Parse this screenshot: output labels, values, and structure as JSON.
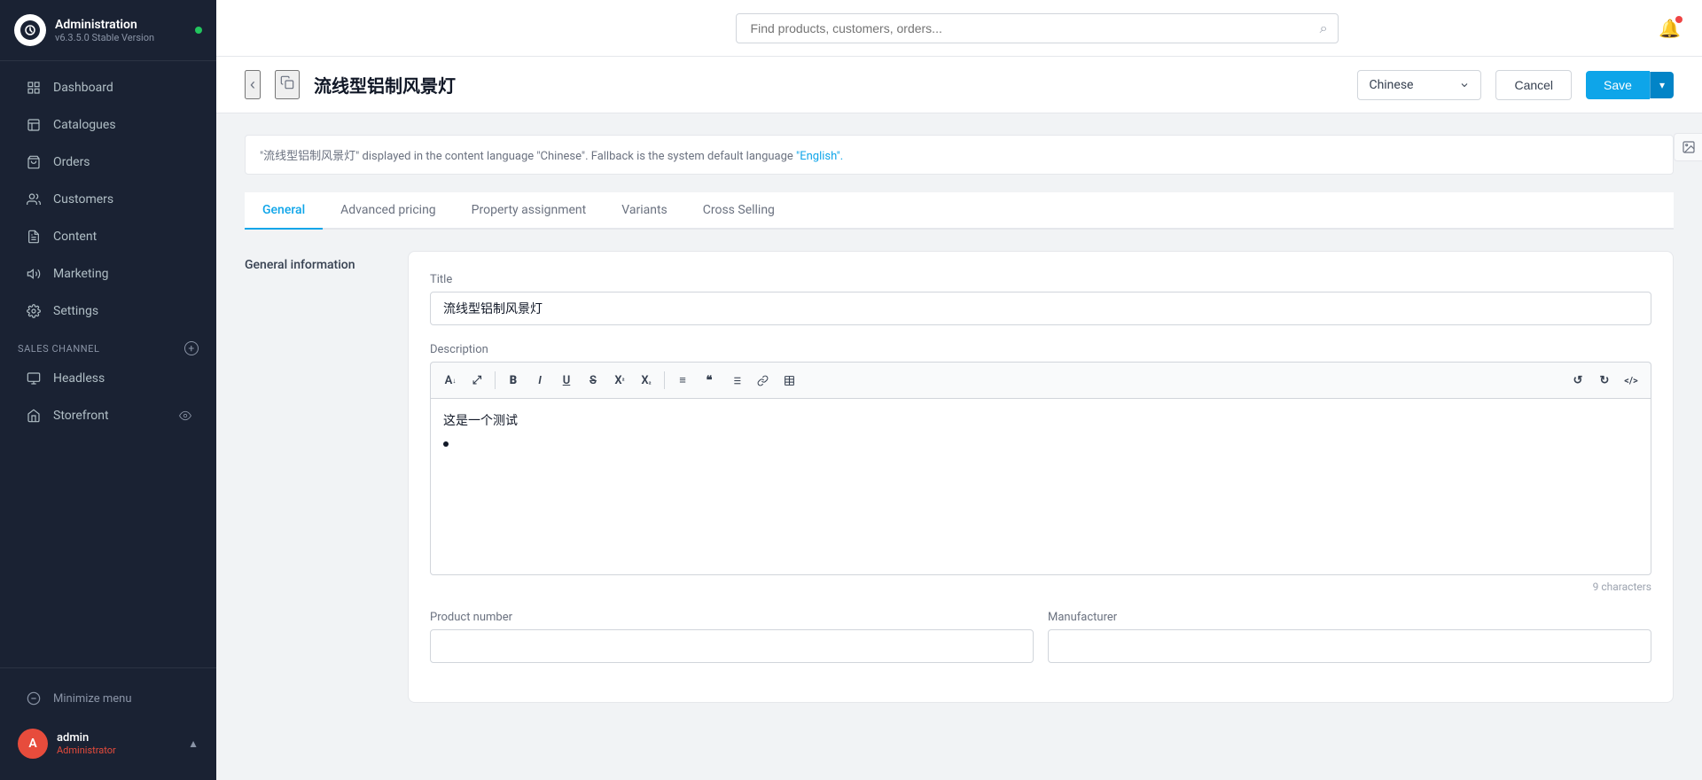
{
  "app": {
    "name": "Administration",
    "version": "v6.3.5.0 Stable Version"
  },
  "sidebar": {
    "nav_items": [
      {
        "id": "dashboard",
        "label": "Dashboard",
        "icon": "grid"
      },
      {
        "id": "catalogues",
        "label": "Catalogues",
        "icon": "book"
      },
      {
        "id": "orders",
        "label": "Orders",
        "icon": "shopping-bag"
      },
      {
        "id": "customers",
        "label": "Customers",
        "icon": "users"
      },
      {
        "id": "content",
        "label": "Content",
        "icon": "file-text"
      },
      {
        "id": "marketing",
        "label": "Marketing",
        "icon": "megaphone"
      },
      {
        "id": "settings",
        "label": "Settings",
        "icon": "settings"
      }
    ],
    "sales_channel_section": "Sales Channel",
    "channel_items": [
      {
        "id": "headless",
        "label": "Headless",
        "icon": "box"
      },
      {
        "id": "storefront",
        "label": "Storefront",
        "icon": "monitor"
      }
    ],
    "minimize_label": "Minimize menu",
    "user": {
      "initials": "A",
      "name": "admin",
      "role": "Administrator"
    }
  },
  "topbar": {
    "search_placeholder": "Find products, customers, orders..."
  },
  "page": {
    "title": "流线型铝制风景灯",
    "language": "Chinese",
    "cancel_label": "Cancel",
    "save_label": "Save",
    "language_notice": "\"流线型铝制风景灯\" displayed in the content language \"Chinese\". Fallback is the system default language",
    "language_notice_link": "\"English\"."
  },
  "tabs": [
    {
      "id": "general",
      "label": "General",
      "active": true
    },
    {
      "id": "advanced-pricing",
      "label": "Advanced pricing",
      "active": false
    },
    {
      "id": "property-assignment",
      "label": "Property assignment",
      "active": false
    },
    {
      "id": "variants",
      "label": "Variants",
      "active": false
    },
    {
      "id": "cross-selling",
      "label": "Cross Selling",
      "active": false
    }
  ],
  "form": {
    "section_label": "General information",
    "title_label": "Title",
    "title_value": "流线型铝制风景灯",
    "description_label": "Description",
    "description_content": "这是一个测试",
    "description_bullet": "•",
    "char_count": "9 characters",
    "product_number_label": "Product number",
    "manufacturer_label": "Manufacturer"
  },
  "rte_toolbar": {
    "buttons": [
      {
        "id": "font-size",
        "label": "A↓",
        "title": "Font size"
      },
      {
        "id": "expand",
        "label": "⤢",
        "title": "Expand"
      },
      {
        "id": "bold",
        "label": "B",
        "title": "Bold"
      },
      {
        "id": "italic",
        "label": "I",
        "title": "Italic"
      },
      {
        "id": "underline",
        "label": "U",
        "title": "Underline"
      },
      {
        "id": "strikethrough",
        "label": "S̶",
        "title": "Strikethrough"
      },
      {
        "id": "superscript",
        "label": "X²",
        "title": "Superscript"
      },
      {
        "id": "subscript",
        "label": "X₂",
        "title": "Subscript"
      },
      {
        "id": "align",
        "label": "≡",
        "title": "Align"
      },
      {
        "id": "blockquote",
        "label": "❝",
        "title": "Blockquote"
      },
      {
        "id": "list",
        "label": "☰",
        "title": "List"
      },
      {
        "id": "link",
        "label": "🔗",
        "title": "Link"
      },
      {
        "id": "table",
        "label": "⊞",
        "title": "Table"
      },
      {
        "id": "undo",
        "label": "↺",
        "title": "Undo"
      },
      {
        "id": "redo",
        "label": "↻",
        "title": "Redo"
      },
      {
        "id": "code",
        "label": "</>",
        "title": "Code"
      }
    ]
  },
  "colors": {
    "accent": "#0ea5e9",
    "sidebar_bg": "#1a2233",
    "active_tab": "#0ea5e9",
    "save_btn": "#0ea5e9"
  }
}
